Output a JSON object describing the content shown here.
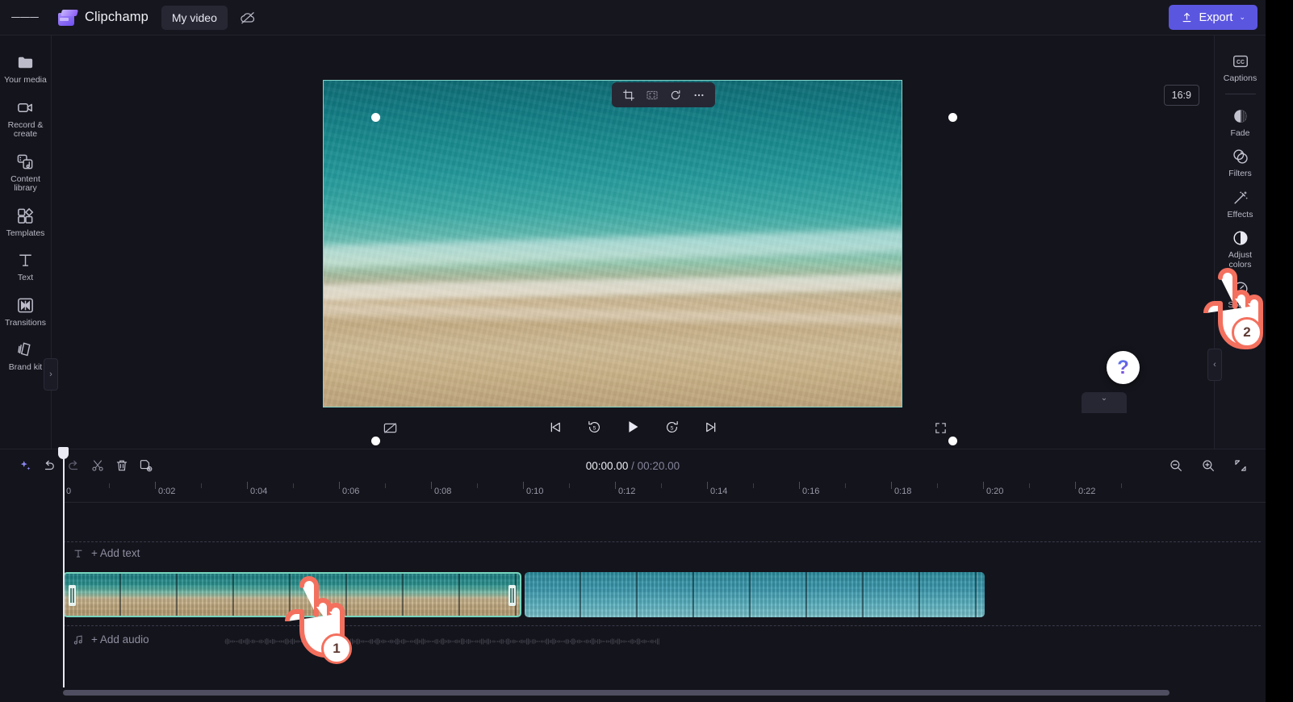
{
  "topbar": {
    "menu_icon": "hamburger-icon",
    "brand": "Clipchamp",
    "project_title": "My video",
    "cloud_icon": "cloud-off-icon",
    "export_label": "Export",
    "export_chevron": "⌄"
  },
  "left_rail": {
    "items": [
      {
        "label": "Your media",
        "icon": "folder-icon"
      },
      {
        "label": "Record & create",
        "icon": "camera-icon"
      },
      {
        "label": "Content library",
        "icon": "library-icon"
      },
      {
        "label": "Templates",
        "icon": "templates-icon"
      },
      {
        "label": "Text",
        "icon": "text-icon"
      },
      {
        "label": "Transitions",
        "icon": "transitions-icon"
      },
      {
        "label": "Brand kit",
        "icon": "brandkit-icon"
      }
    ],
    "expand_chevron": "›"
  },
  "right_rail": {
    "items": [
      {
        "label": "Captions",
        "icon": "cc-icon"
      },
      {
        "label": "Fade",
        "icon": "fade-icon"
      },
      {
        "label": "Filters",
        "icon": "filters-icon"
      },
      {
        "label": "Effects",
        "icon": "effects-icon"
      },
      {
        "label": "Adjust colors",
        "icon": "adjust-colors-icon"
      },
      {
        "label": "Speed",
        "icon": "speed-icon"
      }
    ],
    "collapse_chevron": "‹"
  },
  "preview": {
    "toolbar": [
      {
        "name": "crop-icon"
      },
      {
        "name": "fit-to-frame-icon"
      },
      {
        "name": "rotate-icon"
      },
      {
        "name": "more-options-icon"
      }
    ],
    "aspect_ratio": "16:9",
    "help_label": "?",
    "panel_collapse_chevron": "⌄"
  },
  "player": {
    "captions_toggle": "captions-off-icon",
    "controls": [
      {
        "name": "skip-to-start-button"
      },
      {
        "name": "rewind-5s-button",
        "label": "5"
      },
      {
        "name": "play-button"
      },
      {
        "name": "forward-5s-button",
        "label": "5"
      },
      {
        "name": "skip-to-end-button"
      }
    ],
    "fullscreen": "fullscreen-icon"
  },
  "timeline": {
    "toolbar": [
      {
        "name": "ai-suggestions-button",
        "icon": "sparkle-icon"
      },
      {
        "name": "undo-button",
        "icon": "undo-icon"
      },
      {
        "name": "redo-button",
        "icon": "redo-icon"
      },
      {
        "name": "split-button",
        "icon": "scissors-icon"
      },
      {
        "name": "delete-button",
        "icon": "trash-icon"
      },
      {
        "name": "duplicate-button",
        "icon": "duplicate-icon"
      }
    ],
    "current_time": "00:00.00",
    "separator": "/",
    "total_time": "00:20.00",
    "zoom_out_icon": "zoom-out-icon",
    "zoom_in_icon": "zoom-in-icon",
    "fit_timeline_icon": "fit-timeline-icon",
    "ruler_labels": [
      "0",
      "0:02",
      "0:04",
      "0:06",
      "0:08",
      "0:10",
      "0:12",
      "0:14",
      "0:16",
      "0:18",
      "0:20",
      "0:22"
    ],
    "text_track": {
      "icon": "text-track-icon",
      "label": "+ Add text"
    },
    "audio_track": {
      "icon": "music-note-icon",
      "label": "+ Add audio"
    },
    "clips": [
      {
        "name": "video-clip-beach",
        "selected": true
      },
      {
        "name": "video-clip-ocean",
        "selected": false
      }
    ]
  },
  "annotations": [
    {
      "number": "1",
      "target": "timeline-clip"
    },
    {
      "number": "2",
      "target": "adjust-colors"
    }
  ],
  "colors": {
    "accent": "#5b56e0",
    "selection": "#76d4bd",
    "cursor_outline": "#f4705e",
    "background": "#14141c"
  }
}
